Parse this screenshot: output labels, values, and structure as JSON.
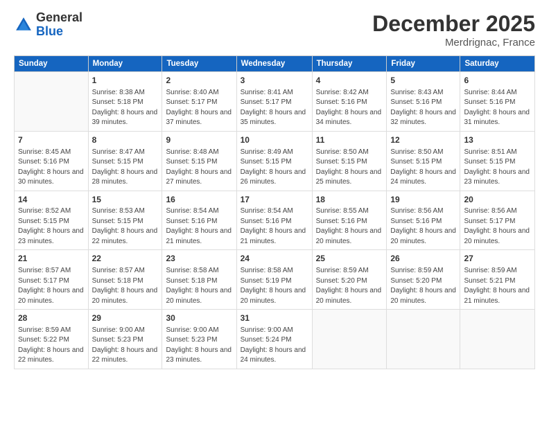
{
  "header": {
    "logo_general": "General",
    "logo_blue": "Blue",
    "month": "December 2025",
    "location": "Merdrignac, France"
  },
  "days_of_week": [
    "Sunday",
    "Monday",
    "Tuesday",
    "Wednesday",
    "Thursday",
    "Friday",
    "Saturday"
  ],
  "weeks": [
    [
      {
        "day": "",
        "empty": true
      },
      {
        "day": "1",
        "sunrise": "Sunrise: 8:38 AM",
        "sunset": "Sunset: 5:18 PM",
        "daylight": "Daylight: 8 hours and 39 minutes."
      },
      {
        "day": "2",
        "sunrise": "Sunrise: 8:40 AM",
        "sunset": "Sunset: 5:17 PM",
        "daylight": "Daylight: 8 hours and 37 minutes."
      },
      {
        "day": "3",
        "sunrise": "Sunrise: 8:41 AM",
        "sunset": "Sunset: 5:17 PM",
        "daylight": "Daylight: 8 hours and 35 minutes."
      },
      {
        "day": "4",
        "sunrise": "Sunrise: 8:42 AM",
        "sunset": "Sunset: 5:16 PM",
        "daylight": "Daylight: 8 hours and 34 minutes."
      },
      {
        "day": "5",
        "sunrise": "Sunrise: 8:43 AM",
        "sunset": "Sunset: 5:16 PM",
        "daylight": "Daylight: 8 hours and 32 minutes."
      },
      {
        "day": "6",
        "sunrise": "Sunrise: 8:44 AM",
        "sunset": "Sunset: 5:16 PM",
        "daylight": "Daylight: 8 hours and 31 minutes."
      }
    ],
    [
      {
        "day": "7",
        "sunrise": "Sunrise: 8:45 AM",
        "sunset": "Sunset: 5:16 PM",
        "daylight": "Daylight: 8 hours and 30 minutes."
      },
      {
        "day": "8",
        "sunrise": "Sunrise: 8:47 AM",
        "sunset": "Sunset: 5:15 PM",
        "daylight": "Daylight: 8 hours and 28 minutes."
      },
      {
        "day": "9",
        "sunrise": "Sunrise: 8:48 AM",
        "sunset": "Sunset: 5:15 PM",
        "daylight": "Daylight: 8 hours and 27 minutes."
      },
      {
        "day": "10",
        "sunrise": "Sunrise: 8:49 AM",
        "sunset": "Sunset: 5:15 PM",
        "daylight": "Daylight: 8 hours and 26 minutes."
      },
      {
        "day": "11",
        "sunrise": "Sunrise: 8:50 AM",
        "sunset": "Sunset: 5:15 PM",
        "daylight": "Daylight: 8 hours and 25 minutes."
      },
      {
        "day": "12",
        "sunrise": "Sunrise: 8:50 AM",
        "sunset": "Sunset: 5:15 PM",
        "daylight": "Daylight: 8 hours and 24 minutes."
      },
      {
        "day": "13",
        "sunrise": "Sunrise: 8:51 AM",
        "sunset": "Sunset: 5:15 PM",
        "daylight": "Daylight: 8 hours and 23 minutes."
      }
    ],
    [
      {
        "day": "14",
        "sunrise": "Sunrise: 8:52 AM",
        "sunset": "Sunset: 5:15 PM",
        "daylight": "Daylight: 8 hours and 23 minutes."
      },
      {
        "day": "15",
        "sunrise": "Sunrise: 8:53 AM",
        "sunset": "Sunset: 5:15 PM",
        "daylight": "Daylight: 8 hours and 22 minutes."
      },
      {
        "day": "16",
        "sunrise": "Sunrise: 8:54 AM",
        "sunset": "Sunset: 5:16 PM",
        "daylight": "Daylight: 8 hours and 21 minutes."
      },
      {
        "day": "17",
        "sunrise": "Sunrise: 8:54 AM",
        "sunset": "Sunset: 5:16 PM",
        "daylight": "Daylight: 8 hours and 21 minutes."
      },
      {
        "day": "18",
        "sunrise": "Sunrise: 8:55 AM",
        "sunset": "Sunset: 5:16 PM",
        "daylight": "Daylight: 8 hours and 20 minutes."
      },
      {
        "day": "19",
        "sunrise": "Sunrise: 8:56 AM",
        "sunset": "Sunset: 5:16 PM",
        "daylight": "Daylight: 8 hours and 20 minutes."
      },
      {
        "day": "20",
        "sunrise": "Sunrise: 8:56 AM",
        "sunset": "Sunset: 5:17 PM",
        "daylight": "Daylight: 8 hours and 20 minutes."
      }
    ],
    [
      {
        "day": "21",
        "sunrise": "Sunrise: 8:57 AM",
        "sunset": "Sunset: 5:17 PM",
        "daylight": "Daylight: 8 hours and 20 minutes."
      },
      {
        "day": "22",
        "sunrise": "Sunrise: 8:57 AM",
        "sunset": "Sunset: 5:18 PM",
        "daylight": "Daylight: 8 hours and 20 minutes."
      },
      {
        "day": "23",
        "sunrise": "Sunrise: 8:58 AM",
        "sunset": "Sunset: 5:18 PM",
        "daylight": "Daylight: 8 hours and 20 minutes."
      },
      {
        "day": "24",
        "sunrise": "Sunrise: 8:58 AM",
        "sunset": "Sunset: 5:19 PM",
        "daylight": "Daylight: 8 hours and 20 minutes."
      },
      {
        "day": "25",
        "sunrise": "Sunrise: 8:59 AM",
        "sunset": "Sunset: 5:20 PM",
        "daylight": "Daylight: 8 hours and 20 minutes."
      },
      {
        "day": "26",
        "sunrise": "Sunrise: 8:59 AM",
        "sunset": "Sunset: 5:20 PM",
        "daylight": "Daylight: 8 hours and 20 minutes."
      },
      {
        "day": "27",
        "sunrise": "Sunrise: 8:59 AM",
        "sunset": "Sunset: 5:21 PM",
        "daylight": "Daylight: 8 hours and 21 minutes."
      }
    ],
    [
      {
        "day": "28",
        "sunrise": "Sunrise: 8:59 AM",
        "sunset": "Sunset: 5:22 PM",
        "daylight": "Daylight: 8 hours and 22 minutes."
      },
      {
        "day": "29",
        "sunrise": "Sunrise: 9:00 AM",
        "sunset": "Sunset: 5:23 PM",
        "daylight": "Daylight: 8 hours and 22 minutes."
      },
      {
        "day": "30",
        "sunrise": "Sunrise: 9:00 AM",
        "sunset": "Sunset: 5:23 PM",
        "daylight": "Daylight: 8 hours and 23 minutes."
      },
      {
        "day": "31",
        "sunrise": "Sunrise: 9:00 AM",
        "sunset": "Sunset: 5:24 PM",
        "daylight": "Daylight: 8 hours and 24 minutes."
      },
      {
        "day": "",
        "empty": true
      },
      {
        "day": "",
        "empty": true
      },
      {
        "day": "",
        "empty": true
      }
    ]
  ]
}
